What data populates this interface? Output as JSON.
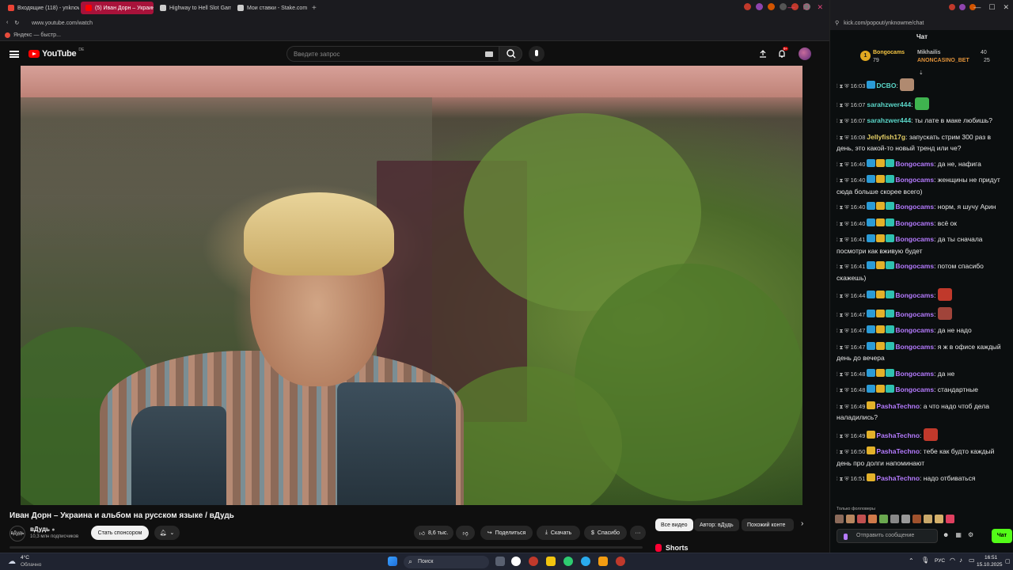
{
  "browser_left": {
    "tabs": [
      {
        "label": "Входящие (118) - ynknow",
        "color": "#ea4335",
        "active": false
      },
      {
        "label": "(5) Иван Дорн – Украина",
        "color": "#ff0000",
        "active": true
      },
      {
        "label": "Highway to Hell Slot Gam",
        "color": "#cccccc",
        "active": false
      },
      {
        "label": "Мои ставки - Stake.com",
        "color": "#cccccc",
        "active": false
      }
    ],
    "new_tab": "+",
    "url": "www.youtube.com/watch",
    "bookmark": "Яндекс — быстр..."
  },
  "youtube": {
    "logo_text": "YouTube",
    "logo_country": "DE",
    "search_placeholder": "Введите запрос",
    "notification_count": "9+",
    "video_title": "Иван Дорн – Украина и альбом на русском языке / вДудь",
    "channel": {
      "name": "вДудь",
      "avatar_text": "вДудь",
      "subscribers": "10,3 млн подписчиков"
    },
    "sponsor_button": "Стать спонсором",
    "likes": "8,6 тыс.",
    "share": "Поделиться",
    "download": "Скачать",
    "thanks": "Спасибо",
    "more": "···",
    "chips": [
      "Все видео",
      "Автор: вДудь",
      "Похожий конте"
    ],
    "chips_next": "›",
    "shorts": "Shorts"
  },
  "browser_right": {
    "url": "kick.com/popout/ynknowme/chat"
  },
  "chat": {
    "title": "Чат",
    "leaderboard": {
      "first_place": "1",
      "first_name": "Bongocams",
      "first_points": "79",
      "second_name": "Mikhailis",
      "second_points": "40",
      "third_name": "ANONCASINO_BET",
      "third_points": "25"
    },
    "messages": [
      {
        "time": "16:03",
        "user": "DCBO",
        "color": "u-teal",
        "badges": [
          "b-blue"
        ],
        "text": "",
        "emote": "#b08a70"
      },
      {
        "time": "16:07",
        "user": "sarahzwer444",
        "color": "u-teal",
        "badges": [],
        "text": "",
        "emote": "#3fb34f"
      },
      {
        "time": "16:07",
        "user": "sarahzwer444",
        "color": "u-teal",
        "badges": [],
        "text": "ты лате в маке любишь?",
        "emote": ""
      },
      {
        "time": "16:08",
        "user": "Jellyfish17g",
        "color": "u-yellow",
        "badges": [],
        "text": "запускать стрим 300 раз в день, это какой-то новый тренд или че?",
        "emote": ""
      },
      {
        "time": "16:40",
        "user": "Bongocams",
        "color": "u-purple",
        "badges": [
          "b-blue",
          "b-gold",
          "b-teal"
        ],
        "text": "да не, нафига",
        "emote": ""
      },
      {
        "time": "16:40",
        "user": "Bongocams",
        "color": "u-purple",
        "badges": [
          "b-blue",
          "b-gold",
          "b-teal"
        ],
        "text": "женщины не придут сюда больше скорее всего)",
        "emote": ""
      },
      {
        "time": "16:40",
        "user": "Bongocams",
        "color": "u-purple",
        "badges": [
          "b-blue",
          "b-gold",
          "b-teal"
        ],
        "text": "норм, я шучу Арин",
        "emote": ""
      },
      {
        "time": "16:40",
        "user": "Bongocams",
        "color": "u-purple",
        "badges": [
          "b-blue",
          "b-gold",
          "b-teal"
        ],
        "text": "всё ок",
        "emote": ""
      },
      {
        "time": "16:41",
        "user": "Bongocams",
        "color": "u-purple",
        "badges": [
          "b-blue",
          "b-gold",
          "b-teal"
        ],
        "text": "да ты сначала посмотри как вживую будет",
        "emote": ""
      },
      {
        "time": "16:41",
        "user": "Bongocams",
        "color": "u-purple",
        "badges": [
          "b-blue",
          "b-gold",
          "b-teal"
        ],
        "text": "потом спасибо скажешь)",
        "emote": ""
      },
      {
        "time": "16:44",
        "user": "Bongocams",
        "color": "u-purple",
        "badges": [
          "b-blue",
          "b-gold",
          "b-teal"
        ],
        "text": "",
        "emote": "#c0392b"
      },
      {
        "time": "16:47",
        "user": "Bongocams",
        "color": "u-purple",
        "badges": [
          "b-blue",
          "b-gold",
          "b-teal"
        ],
        "text": "",
        "emote": "#a0443a"
      },
      {
        "time": "16:47",
        "user": "Bongocams",
        "color": "u-purple",
        "badges": [
          "b-blue",
          "b-gold",
          "b-teal"
        ],
        "text": "да не надо",
        "emote": ""
      },
      {
        "time": "16:47",
        "user": "Bongocams",
        "color": "u-purple",
        "badges": [
          "b-blue",
          "b-gold",
          "b-teal"
        ],
        "text": "я ж в офисе каждый день до вечера",
        "emote": ""
      },
      {
        "time": "16:48",
        "user": "Bongocams",
        "color": "u-purple",
        "badges": [
          "b-blue",
          "b-gold",
          "b-teal"
        ],
        "text": "да не",
        "emote": ""
      },
      {
        "time": "16:48",
        "user": "Bongocams",
        "color": "u-purple",
        "badges": [
          "b-blue",
          "b-gold",
          "b-teal"
        ],
        "text": "стандартные",
        "emote": ""
      },
      {
        "time": "16:49",
        "user": "PashaTechno",
        "color": "u-purple",
        "badges": [
          "b-gold"
        ],
        "text": "а что надо чтоб дела наладились?",
        "emote": ""
      },
      {
        "time": "16:49",
        "user": "PashaTechno",
        "color": "u-purple",
        "badges": [
          "b-gold"
        ],
        "text": "",
        "emote": "#c0392b"
      },
      {
        "time": "16:50",
        "user": "PashaTechno",
        "color": "u-purple",
        "badges": [
          "b-gold"
        ],
        "text": "тебе как будто каждый день про долги напоминают",
        "emote": ""
      },
      {
        "time": "16:51",
        "user": "PashaTechno",
        "color": "u-purple",
        "badges": [
          "b-gold"
        ],
        "text": "надо отбиваться",
        "emote": ""
      }
    ],
    "followers_only": "Только фолловеры",
    "input_placeholder": "Отправить сообщение",
    "send_label": "Чат",
    "emote_colors": [
      "#8a6a5a",
      "#b7865f",
      "#c05050",
      "#d07a4a",
      "#6aa84f",
      "#888888",
      "#999999",
      "#a0522d",
      "#c9a86a",
      "#d4b06a",
      "#e04060"
    ]
  },
  "taskbar": {
    "weather_temp": "4°C",
    "weather_text": "Облачно",
    "search_label": "Поиск",
    "lang": "РУС",
    "time": "16:51",
    "date": "15.10.2025"
  }
}
